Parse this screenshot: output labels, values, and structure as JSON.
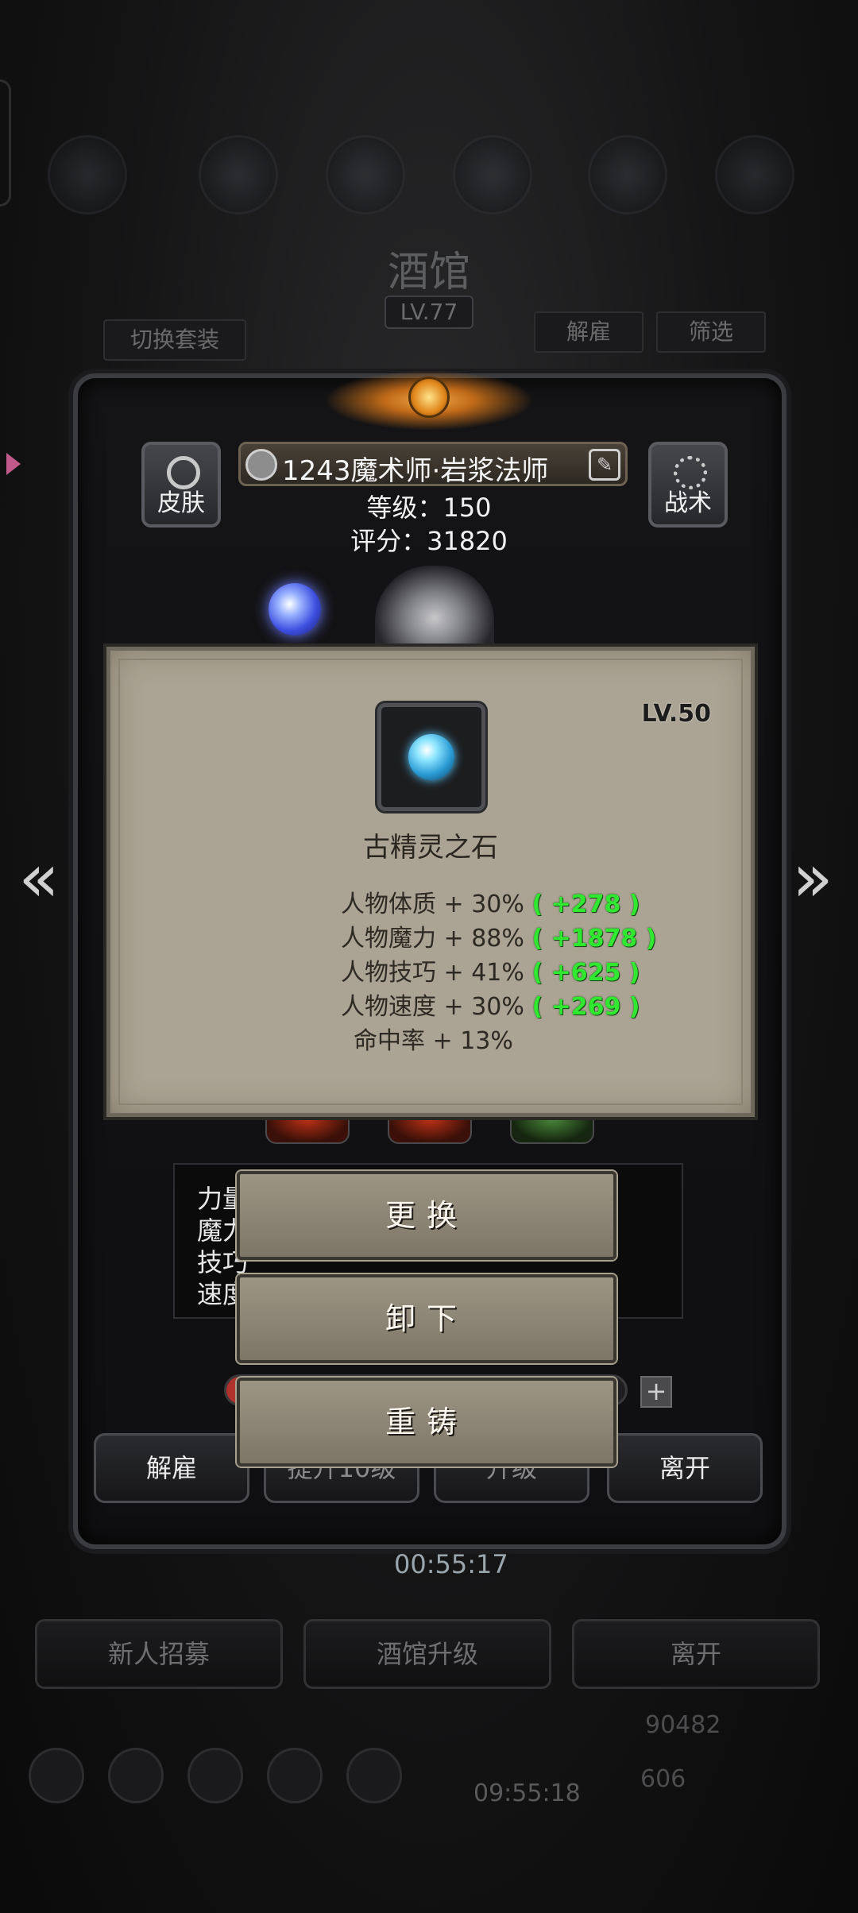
{
  "background": {
    "title": "酒馆",
    "level": "LV.77",
    "switch_outfit": "切换套装",
    "dismiss": "解雇",
    "filter": "筛选",
    "timer_top": "00:55:17",
    "bottom_buttons": [
      "新人招募",
      "酒馆升级",
      "离开"
    ],
    "gold": "90482",
    "gems": "606",
    "timer_bottom": "09:55:18"
  },
  "hero": {
    "skin_label": "皮肤",
    "tactics_label": "战术",
    "name": "1243魔术师·岩浆法师",
    "level_line": "等级：150",
    "score_line": "评分：31820"
  },
  "stats_hidden": {
    "rows": [
      "力量",
      "魔力",
      "技巧",
      "速度"
    ]
  },
  "panel_footer": {
    "dismiss": "解雇",
    "upgrade10": "提升10级",
    "upgrade": "升级",
    "leave": "离开"
  },
  "item": {
    "level": "LV.50",
    "name": "古精灵之石",
    "attributes": [
      {
        "base": "人物体质 + 30%",
        "bonus": "( +278 )"
      },
      {
        "base": "人物魔力 + 88%",
        "bonus": "( +1878 )"
      },
      {
        "base": "人物技巧 + 41%",
        "bonus": "( +625 )"
      },
      {
        "base": "人物速度 + 30%",
        "bonus": "( +269 )"
      },
      {
        "base": "命中率 + 13%",
        "bonus": ""
      }
    ]
  },
  "actions": {
    "replace": "更换",
    "unequip": "卸下",
    "reforge": "重铸"
  },
  "exp_progress": 0.92,
  "colors": {
    "popup_bg": "#aba393",
    "bonus_green": "#2fe82f",
    "action_bg": "#8d8575"
  },
  "icons": {
    "prev": "chevron-left-double-icon",
    "next": "chevron-right-double-icon",
    "skin": "shirt-icon",
    "tactics": "gear-icon",
    "edit": "edit-icon"
  }
}
